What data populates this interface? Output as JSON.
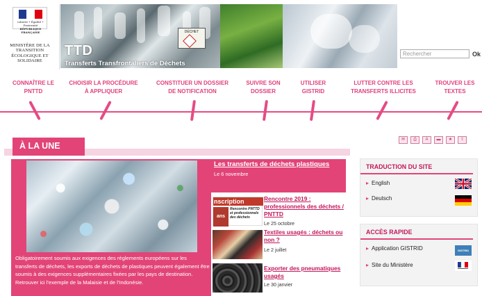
{
  "header": {
    "logo": {
      "motto": "Liberté • Égalité • Fraternité",
      "republic": "RÉPUBLIQUE FRANÇAISE",
      "ministry": "MINISTÈRE DE LA TRANSITION ÉCOLOGIQUE ET SOLIDAIRE"
    },
    "site_name": "TTD",
    "site_subtitle": "Transferts Transfrontaliers de Déchets",
    "banner_label": "DÉCHET",
    "search": {
      "placeholder": "Rechercher",
      "button": "Ok"
    }
  },
  "nav": {
    "items": [
      {
        "line1": "CONNAÎTRE LE",
        "line2": "PNTTD"
      },
      {
        "line1": "CHOISIR LA PROCÉDURE",
        "line2": "À APPLIQUER"
      },
      {
        "line1": "CONSTITUER UN DOSSIER",
        "line2": "DE NOTIFICATION"
      },
      {
        "line1": "SUIVRE SON",
        "line2": "DOSSIER"
      },
      {
        "line1": "UTILISER",
        "line2": "GISTRID"
      },
      {
        "line1": "LUTTER CONTRE LES",
        "line2": "TRANSFERTS ILLICITES"
      },
      {
        "line1": "TROUVER LES",
        "line2": "TEXTES"
      }
    ],
    "accent": "#e24478"
  },
  "une": {
    "title": "À LA UNE",
    "tools": [
      "email-icon",
      "print-icon",
      "font-size-icon",
      "pdf-icon",
      "bookmark-icon",
      "share-icon"
    ],
    "feature": {
      "title": "Les transferts de déchets plastiques",
      "date": "Le 6 novembre",
      "text": "Obligatoirement soumis aux exigences des règlements européens sur les transferts de déchets, les exports de déchets de plastiques peuvent également être soumis à des exigences supplémentaires fixées par les pays de destination. Retrouver ici l'exemple de la Malaisie et de l'Indonésie."
    },
    "news": [
      {
        "title": "Rencontre 2019 : professionnels des déchets / PNTTD",
        "date": "Le 25 octobre",
        "thumb_text": "nscription",
        "thumb_sub": "Rencontre PNTTD et professionnels des déchets",
        "thumb_year": "ans"
      },
      {
        "title": "Textiles usagés : déchets ou non ?",
        "date": "Le 2 juillet"
      },
      {
        "title": "Exporter des pneumatiques usagés",
        "date": "Le 30 janvier"
      }
    ]
  },
  "sidebar": {
    "translation": {
      "title": "TRADUCTION DU SITE",
      "items": [
        {
          "label": "English"
        },
        {
          "label": "Deutsch"
        }
      ]
    },
    "quick_access": {
      "title": "ACCÈS RAPIDE",
      "items": [
        {
          "label": "Application GISTRID",
          "badge": "GISTRID"
        },
        {
          "label": "Site du Ministère"
        }
      ]
    }
  }
}
